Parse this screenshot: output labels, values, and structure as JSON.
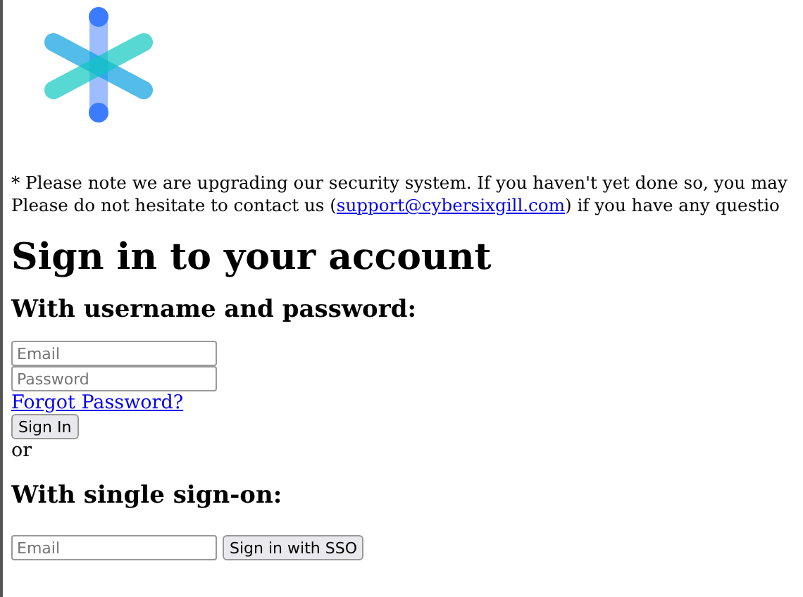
{
  "notice": {
    "line_1": "* Please note we are upgrading our security system. If you haven't yet done so, you may",
    "line_2_before": "Please do not hesitate to contact us (",
    "line_2_link": "support@cybersixgill.com",
    "line_2_after": ") if you have any questio"
  },
  "title": "Sign in to your account",
  "password_section": {
    "heading": "With username and password:",
    "email_placeholder": "Email",
    "password_placeholder": "Password",
    "forgot_link": "Forgot Password?",
    "button": "Sign In"
  },
  "separator": "or",
  "sso_section": {
    "heading": "With single sign-on:",
    "email_placeholder": "Email",
    "button": "Sign in with SSO"
  }
}
